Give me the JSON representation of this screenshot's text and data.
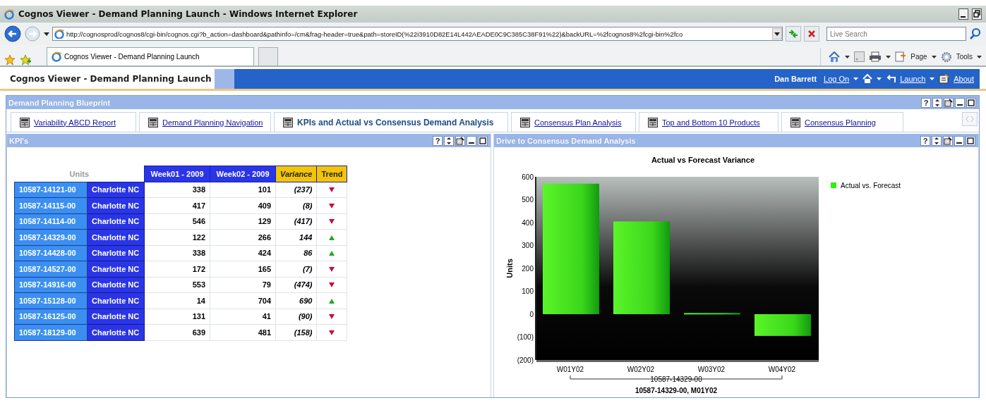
{
  "window": {
    "title": "Cognos Viewer - Demand Planning Launch - Windows Internet Explorer"
  },
  "browser": {
    "address": "http://cognosprod/cognos8/cgi-bin/cognos.cgi?b_action=dashboard&pathinfo=/cm&frag-header=true&path=storeID(%22i3910D82E14L442AEADE0C9C385C38F91%22)&backURL=%2fcognos8%2fcgi-bin%2fco",
    "search_placeholder": "Live Search",
    "tabs": [
      {
        "label": "Cognos Viewer - Demand Planning Launch",
        "selected": true
      }
    ],
    "toolbar": [
      "Page",
      "Tools"
    ]
  },
  "app_header": {
    "title": "Cognos Viewer - Demand Planning Launch",
    "user": "Dan Barrett",
    "links": [
      "Log On",
      "Launch",
      "About"
    ]
  },
  "portal": {
    "title": "Demand Planning Blueprint",
    "help": "?",
    "tabs": [
      {
        "label": "Variability ABCD Report",
        "selected": false
      },
      {
        "label": "Demand Planning Navigation",
        "selected": false
      },
      {
        "label": "KPIs and Actual vs Consensus Demand Analysis",
        "selected": true
      },
      {
        "label": "Consensus Plan Analysis",
        "selected": false
      },
      {
        "label": "Top and Bottom 10 Products",
        "selected": false
      },
      {
        "label": "Consensus Planning",
        "selected": false
      }
    ]
  },
  "kpi_panel": {
    "title": "KPI's",
    "help": "?",
    "table": {
      "corner": "Units",
      "columns": [
        "Week01 - 2009",
        "Week02 - 2009",
        "Variance",
        "Trend"
      ],
      "rows": [
        {
          "product": "10587-14121-00",
          "location": "Charlotte NC",
          "week01": "338",
          "week02": "101",
          "variance": "(237)",
          "kind": "down"
        },
        {
          "product": "10587-14115-00",
          "location": "Charlotte NC",
          "week01": "417",
          "week02": "409",
          "variance": "(8)",
          "kind": "down"
        },
        {
          "product": "10587-14114-00",
          "location": "Charlotte NC",
          "week01": "546",
          "week02": "129",
          "variance": "(417)",
          "kind": "down"
        },
        {
          "product": "10587-14329-00",
          "location": "Charlotte NC",
          "week01": "122",
          "week02": "266",
          "variance": "144",
          "kind": "up"
        },
        {
          "product": "10587-14428-00",
          "location": "Charlotte NC",
          "week01": "338",
          "week02": "424",
          "variance": "86",
          "kind": "up"
        },
        {
          "product": "10587-14527-00",
          "location": "Charlotte NC",
          "week01": "172",
          "week02": "165",
          "variance": "(7)",
          "kind": "down"
        },
        {
          "product": "10587-14916-00",
          "location": "Charlotte NC",
          "week01": "553",
          "week02": "79",
          "variance": "(474)",
          "kind": "down"
        },
        {
          "product": "10587-15128-00",
          "location": "Charlotte NC",
          "week01": "14",
          "week02": "704",
          "variance": "690",
          "kind": "up"
        },
        {
          "product": "10587-16125-00",
          "location": "Charlotte NC",
          "week01": "131",
          "week02": "41",
          "variance": "(90)",
          "kind": "down"
        },
        {
          "product": "10587-18129-00",
          "location": "Charlotte NC",
          "week01": "639",
          "week02": "481",
          "variance": "(158)",
          "kind": "down"
        }
      ]
    }
  },
  "chart_panel": {
    "title": "Drive to Consensus Demand Analysis",
    "help": "?",
    "group_label": "10587-14329-00",
    "chart_data": {
      "type": "bar",
      "title": "Actual vs Forecast Variance",
      "xlabel": "10587-14329-00, M01Y02",
      "ylabel": "Units",
      "categories": [
        "W01Y02",
        "W02Y02",
        "W03Y02",
        "W04Y02"
      ],
      "series": [
        {
          "name": "Actual vs. Forecast",
          "color": "#33ee11",
          "values": [
            570,
            405,
            5,
            -95
          ]
        }
      ],
      "ylim": [
        -200,
        600
      ],
      "yticks": [
        600,
        {
          "value": 500,
          "label": "500"
        },
        400,
        300,
        200,
        100,
        0,
        {
          "value": -100,
          "label": "(100)"
        },
        {
          "value": -200,
          "label": "(200)"
        }
      ]
    }
  }
}
